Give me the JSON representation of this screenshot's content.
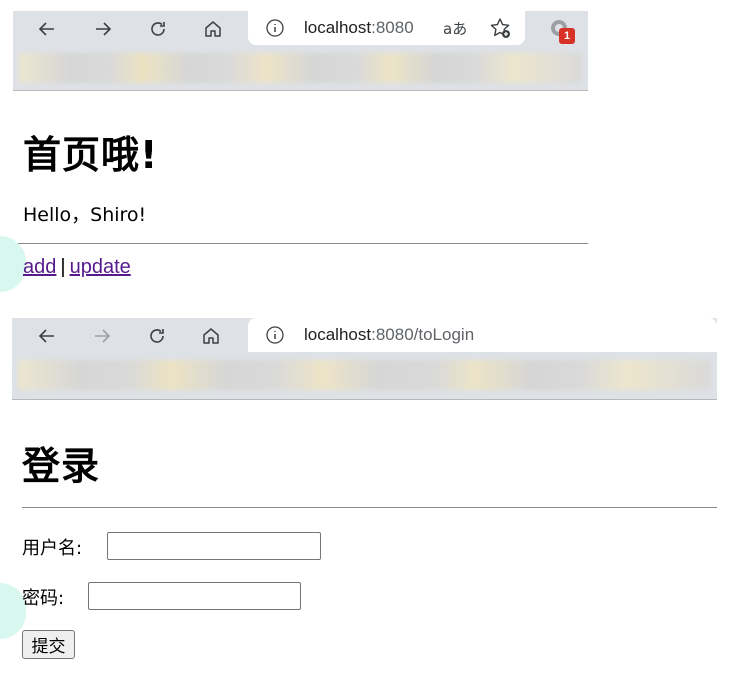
{
  "home": {
    "url_host": "localhost",
    "url_rest": ":8080",
    "read_aloud_label": "aあ",
    "extension_badge": "1",
    "heading": "首页哦!",
    "greeting": "Hello，Shiro!",
    "link_add": "add",
    "link_separator": "|",
    "link_update": "update"
  },
  "login": {
    "url_host": "localhost",
    "url_rest": ":8080/toLogin",
    "heading": "登录",
    "username_label": "用户名:",
    "username_value": "",
    "password_label": "密码:",
    "password_value": "",
    "submit_label": "提交"
  },
  "colors": {
    "chrome_bg": "#dee1e6",
    "visited_link": "#551a8b",
    "badge": "#d93025"
  },
  "icons": [
    "back-arrow-icon",
    "forward-arrow-icon",
    "refresh-icon",
    "home-icon",
    "info-icon",
    "read-aloud-icon",
    "favorite-star-icon",
    "extension-icon"
  ]
}
